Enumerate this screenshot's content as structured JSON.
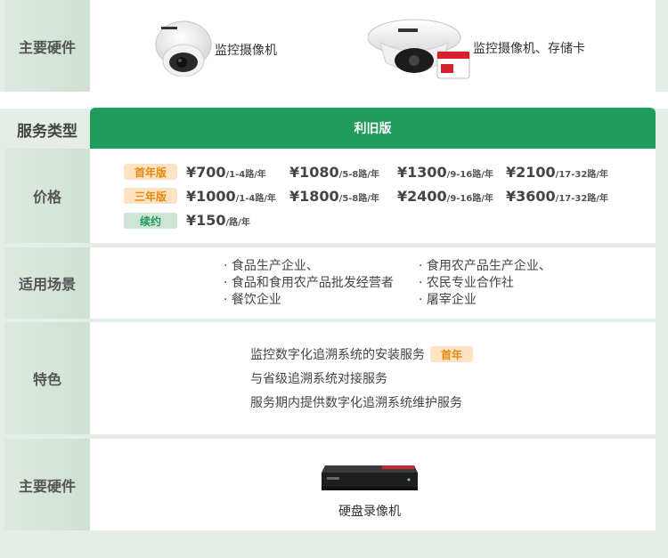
{
  "rows": {
    "hardware_top": {
      "label": "主要硬件",
      "items": [
        {
          "label": "监控摄像机",
          "icon": "dome-camera-icon"
        },
        {
          "label": "监控摄像机、存储卡",
          "icon": "ptz-camera-icon"
        }
      ]
    },
    "service_type": {
      "label": "服务类型",
      "header": "利旧版"
    },
    "price": {
      "label": "价格",
      "lines": [
        {
          "tag": "首年版",
          "tag_color": "orange",
          "prices": [
            {
              "amount": "¥700",
              "unit": "/1-4路/年"
            },
            {
              "amount": "¥1080",
              "unit": "/5-8路/年"
            },
            {
              "amount": "¥1300",
              "unit": "/9-16路/年"
            },
            {
              "amount": "¥2100",
              "unit": "/17-32路/年"
            }
          ]
        },
        {
          "tag": "三年版",
          "tag_color": "orange",
          "prices": [
            {
              "amount": "¥1000",
              "unit": "/1-4路/年"
            },
            {
              "amount": "¥1800",
              "unit": "/5-8路/年"
            },
            {
              "amount": "¥2400",
              "unit": "/9-16路/年"
            },
            {
              "amount": "¥3600",
              "unit": "/17-32路/年"
            }
          ]
        },
        {
          "tag": "续约",
          "tag_color": "green",
          "prices": [
            {
              "amount": "¥150",
              "unit": "/路/年"
            }
          ]
        }
      ]
    },
    "scenarios": {
      "label": "适用场景",
      "left": [
        "· 食品生产企业、",
        "· 食品和食用农产品批发经营者",
        "· 餐饮企业"
      ],
      "right": [
        "· 食用农产品生产企业、",
        "· 农民专业合作社",
        "· 屠宰企业"
      ]
    },
    "features": {
      "label": "特色",
      "items": [
        {
          "text": "监控数字化追溯系统的安装服务",
          "tag": "首年"
        },
        {
          "text": "与省级追溯系统对接服务",
          "tag": ""
        },
        {
          "text": "服务期内提供数字化追溯系统维护服务",
          "tag": ""
        }
      ]
    },
    "hardware_bottom": {
      "label": "主要硬件",
      "item": {
        "label": "硬盘录像机",
        "icon": "nvr-recorder-icon"
      }
    }
  },
  "colors": {
    "accent_green": "#1f9b5c",
    "tag_orange_bg": "#fde3c2",
    "tag_orange_text": "#e38a10",
    "tag_green_bg": "#cfe4d5",
    "page_bg": "#e4ede6"
  }
}
